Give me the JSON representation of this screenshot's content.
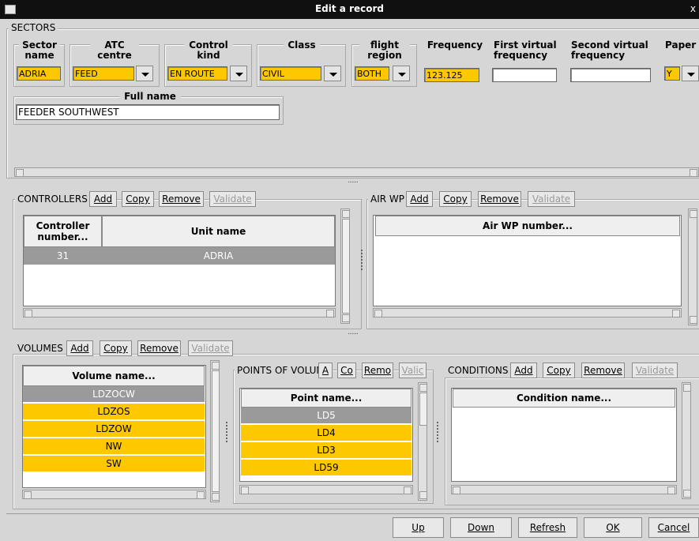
{
  "window": {
    "title": "Edit a record",
    "close": "x"
  },
  "sectors": {
    "label": "SECTORS",
    "headers": {
      "sector_name": "Sector name",
      "atc": "ATC centre",
      "control_kind": "Control kind",
      "class": "Class",
      "flight_region": "flight region",
      "frequency": "Frequency",
      "first_virtual": "First virtual frequency",
      "second_virtual": "Second virtual frequency",
      "paper": "Paper"
    },
    "values": {
      "sector_name": "ADRIA",
      "atc": "FEED",
      "control_kind": "EN ROUTE",
      "class": "CIVIL",
      "flight_region": "BOTH",
      "frequency": "123.125",
      "first_virtual": "",
      "second_virtual": "",
      "paper": "Y"
    },
    "full_name_label": "Full name",
    "full_name": "FEEDER SOUTHWEST"
  },
  "controllers": {
    "label": "CONTROLLERS",
    "buttons": {
      "add": "Add",
      "copy": "Copy",
      "remove": "Remove",
      "validate": "Validate"
    },
    "columns": [
      "Controller number...",
      "Unit name"
    ],
    "rows": [
      {
        "number": "31",
        "unit": "ADRIA"
      }
    ]
  },
  "air_wp": {
    "label": "AIR WP",
    "buttons": {
      "add": "Add",
      "copy": "Copy",
      "remove": "Remove",
      "validate": "Validate"
    },
    "column": "Air WP number..."
  },
  "volumes": {
    "label": "VOLUMES",
    "buttons": {
      "add": "Add",
      "copy": "Copy",
      "remove": "Remove",
      "validate": "Validate"
    },
    "column": "Volume name...",
    "rows": [
      "LDZOCW",
      "LDZOS",
      "LDZOW",
      "NW",
      "SW"
    ]
  },
  "points": {
    "label": "POINTS OF VOLUM",
    "buttons": {
      "add": "A",
      "copy": "Co",
      "remove": "Remo",
      "validate": "Valic"
    },
    "column": "Point name...",
    "rows": [
      "LD5",
      "LD4",
      "LD3",
      "LD59"
    ]
  },
  "conditions": {
    "label": "CONDITIONS",
    "buttons": {
      "add": "Add",
      "copy": "Copy",
      "remove": "Remove",
      "validate": "Validate"
    },
    "column": "Condition name..."
  },
  "footer": {
    "up": "Up",
    "down": "Down",
    "refresh": "Refresh",
    "ok": "OK",
    "cancel": "Cancel"
  },
  "colors": {
    "required_field": "#fdc800",
    "selected_row": "#9a9a9a"
  }
}
